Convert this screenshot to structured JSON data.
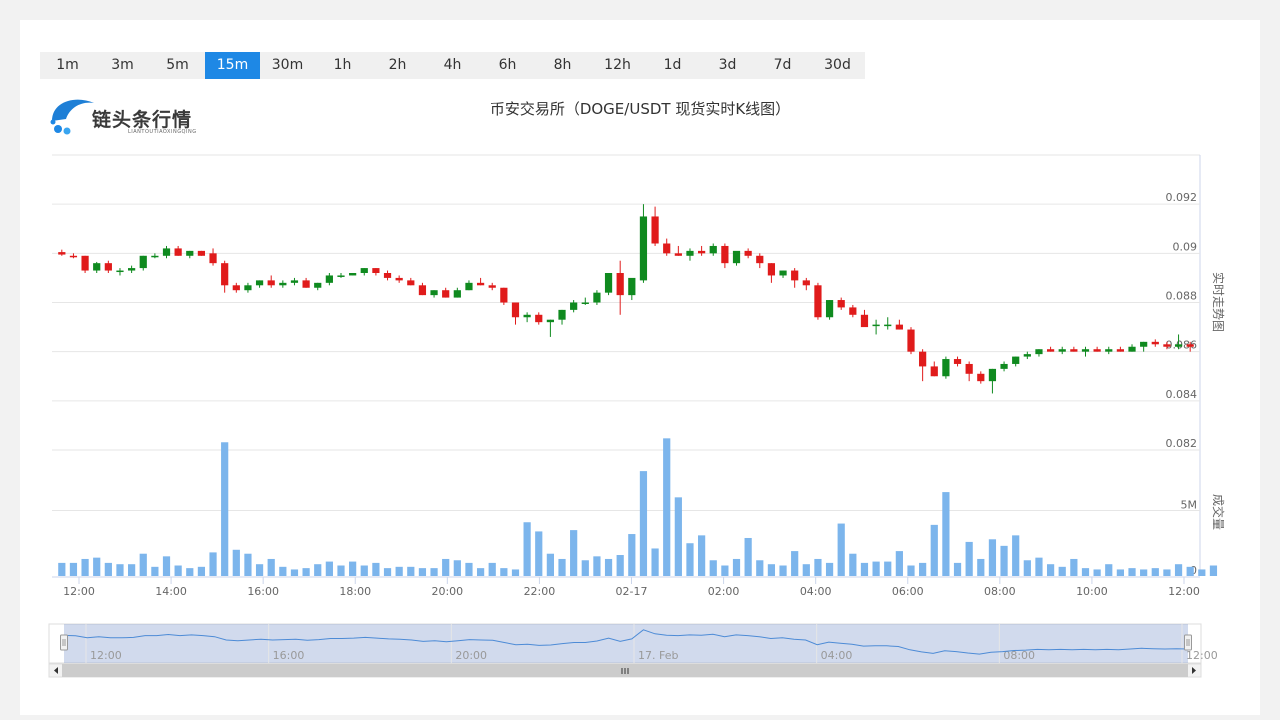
{
  "timeframes": [
    "1m",
    "3m",
    "5m",
    "15m",
    "30m",
    "1h",
    "2h",
    "4h",
    "6h",
    "8h",
    "12h",
    "1d",
    "3d",
    "7d",
    "30d"
  ],
  "active_timeframe": "15m",
  "logo": {
    "name": "链头条行情",
    "sub": "LIANTOUTIAOXINGQING"
  },
  "title": "币安交易所（DOGE/USDT 现货实时K线图）",
  "colors": {
    "up": "#0f8a1f",
    "down": "#e01b1b",
    "volume": "#7cb5ec",
    "accent": "#1e88e5"
  },
  "chart_data": {
    "type": "candlestick",
    "price_axis": {
      "label": "实时走势图",
      "ticks": [
        "0.092",
        "0.09",
        "0.088",
        "0.086",
        "0.084",
        "0.082"
      ],
      "ylim": [
        0.082,
        0.094
      ]
    },
    "volume_axis": {
      "label": "成交量",
      "ticks": [
        "5M",
        "0"
      ],
      "ylim": [
        0,
        9
      ]
    },
    "x_ticks": [
      "12:00",
      "14:00",
      "16:00",
      "18:00",
      "20:00",
      "22:00",
      "02-17",
      "02:00",
      "04:00",
      "06:00",
      "08:00",
      "10:00",
      "12:00"
    ],
    "navigator_ticks": [
      "12:00",
      "16:00",
      "20:00",
      "17. Feb",
      "04:00",
      "08:00",
      "12:00"
    ],
    "candles_ohlc": [
      [
        0.09005,
        0.09015,
        0.0899,
        0.08995
      ],
      [
        0.0899,
        0.09,
        0.0898,
        0.08985
      ],
      [
        0.0899,
        0.0899,
        0.0892,
        0.0893
      ],
      [
        0.0893,
        0.08965,
        0.0892,
        0.0896
      ],
      [
        0.0896,
        0.0897,
        0.0892,
        0.0893
      ],
      [
        0.0893,
        0.0894,
        0.0891,
        0.0893
      ],
      [
        0.0893,
        0.0895,
        0.0892,
        0.0894
      ],
      [
        0.0894,
        0.0899,
        0.0893,
        0.0899
      ],
      [
        0.0899,
        0.09,
        0.0898,
        0.0899
      ],
      [
        0.0899,
        0.0903,
        0.0898,
        0.0902
      ],
      [
        0.0902,
        0.0903,
        0.0899,
        0.0899
      ],
      [
        0.0899,
        0.0901,
        0.0898,
        0.0901
      ],
      [
        0.0901,
        0.0901,
        0.0899,
        0.0899
      ],
      [
        0.09,
        0.0902,
        0.0895,
        0.0896
      ],
      [
        0.0896,
        0.0897,
        0.0884,
        0.0887
      ],
      [
        0.0887,
        0.0888,
        0.0884,
        0.0885
      ],
      [
        0.0885,
        0.0888,
        0.0884,
        0.0887
      ],
      [
        0.0887,
        0.0889,
        0.0886,
        0.0889
      ],
      [
        0.0889,
        0.0891,
        0.0886,
        0.0887
      ],
      [
        0.0887,
        0.0889,
        0.0886,
        0.0888
      ],
      [
        0.0888,
        0.089,
        0.0887,
        0.0889
      ],
      [
        0.0889,
        0.089,
        0.0886,
        0.0886
      ],
      [
        0.0886,
        0.0888,
        0.0885,
        0.0888
      ],
      [
        0.0888,
        0.0892,
        0.0887,
        0.0891
      ],
      [
        0.0891,
        0.0892,
        0.089,
        0.0891
      ],
      [
        0.0891,
        0.0892,
        0.0891,
        0.0892
      ],
      [
        0.0892,
        0.0894,
        0.0891,
        0.0894
      ],
      [
        0.0894,
        0.0894,
        0.0891,
        0.0892
      ],
      [
        0.0892,
        0.0893,
        0.0889,
        0.089
      ],
      [
        0.089,
        0.0891,
        0.0888,
        0.0889
      ],
      [
        0.0889,
        0.089,
        0.0887,
        0.0887
      ],
      [
        0.0887,
        0.0888,
        0.0883,
        0.0883
      ],
      [
        0.0883,
        0.0885,
        0.0882,
        0.0885
      ],
      [
        0.0885,
        0.0886,
        0.0882,
        0.0882
      ],
      [
        0.0882,
        0.0886,
        0.0882,
        0.0885
      ],
      [
        0.0885,
        0.0889,
        0.0885,
        0.0888
      ],
      [
        0.0888,
        0.089,
        0.0887,
        0.0887
      ],
      [
        0.0887,
        0.0888,
        0.0885,
        0.0886
      ],
      [
        0.0886,
        0.0886,
        0.0879,
        0.088
      ],
      [
        0.088,
        0.088,
        0.0871,
        0.0874
      ],
      [
        0.0874,
        0.0876,
        0.0872,
        0.0875
      ],
      [
        0.0875,
        0.0876,
        0.0871,
        0.0872
      ],
      [
        0.0872,
        0.0873,
        0.0866,
        0.0873
      ],
      [
        0.0873,
        0.0877,
        0.0871,
        0.0877
      ],
      [
        0.0877,
        0.0881,
        0.0876,
        0.088
      ],
      [
        0.088,
        0.0882,
        0.0879,
        0.088
      ],
      [
        0.088,
        0.0885,
        0.0879,
        0.0884
      ],
      [
        0.0884,
        0.0892,
        0.0883,
        0.0892
      ],
      [
        0.0892,
        0.0897,
        0.0875,
        0.0883
      ],
      [
        0.0883,
        0.0889,
        0.0881,
        0.089
      ],
      [
        0.0889,
        0.092,
        0.0888,
        0.0915
      ],
      [
        0.0915,
        0.0919,
        0.0903,
        0.0904
      ],
      [
        0.0904,
        0.0906,
        0.0899,
        0.09
      ],
      [
        0.09,
        0.0903,
        0.0899,
        0.0899
      ],
      [
        0.0899,
        0.0902,
        0.0897,
        0.0901
      ],
      [
        0.0901,
        0.0903,
        0.0899,
        0.09
      ],
      [
        0.09,
        0.0904,
        0.0899,
        0.0903
      ],
      [
        0.0903,
        0.0904,
        0.0894,
        0.0896
      ],
      [
        0.0896,
        0.09,
        0.0895,
        0.0901
      ],
      [
        0.0901,
        0.0902,
        0.0898,
        0.0899
      ],
      [
        0.0899,
        0.09,
        0.0894,
        0.0896
      ],
      [
        0.0896,
        0.0896,
        0.0888,
        0.0891
      ],
      [
        0.0891,
        0.0893,
        0.089,
        0.0893
      ],
      [
        0.0893,
        0.0894,
        0.0886,
        0.0889
      ],
      [
        0.0889,
        0.089,
        0.0885,
        0.0887
      ],
      [
        0.0887,
        0.0888,
        0.0873,
        0.0874
      ],
      [
        0.0874,
        0.0881,
        0.0873,
        0.0881
      ],
      [
        0.0881,
        0.0882,
        0.0877,
        0.0878
      ],
      [
        0.0878,
        0.0879,
        0.0874,
        0.0875
      ],
      [
        0.0875,
        0.0877,
        0.0871,
        0.087
      ],
      [
        0.0871,
        0.0873,
        0.0867,
        0.0871
      ],
      [
        0.0871,
        0.0874,
        0.0869,
        0.0871
      ],
      [
        0.0871,
        0.0873,
        0.0869,
        0.0869
      ],
      [
        0.0869,
        0.087,
        0.0859,
        0.086
      ],
      [
        0.086,
        0.0861,
        0.0848,
        0.0854
      ],
      [
        0.0854,
        0.0856,
        0.085,
        0.085
      ],
      [
        0.085,
        0.0858,
        0.0849,
        0.0857
      ],
      [
        0.0857,
        0.0858,
        0.0854,
        0.0855
      ],
      [
        0.0855,
        0.0856,
        0.0848,
        0.0851
      ],
      [
        0.0851,
        0.0852,
        0.0847,
        0.0848
      ],
      [
        0.0848,
        0.0853,
        0.0843,
        0.0853
      ],
      [
        0.0853,
        0.0856,
        0.0852,
        0.0855
      ],
      [
        0.0855,
        0.0858,
        0.0854,
        0.0858
      ],
      [
        0.0858,
        0.086,
        0.0857,
        0.0859
      ],
      [
        0.0859,
        0.0861,
        0.0858,
        0.0861
      ],
      [
        0.0861,
        0.0862,
        0.086,
        0.086
      ],
      [
        0.086,
        0.0862,
        0.0859,
        0.0861
      ],
      [
        0.0861,
        0.0862,
        0.086,
        0.086
      ],
      [
        0.086,
        0.0862,
        0.0858,
        0.0861
      ],
      [
        0.0861,
        0.0862,
        0.086,
        0.086
      ],
      [
        0.086,
        0.0862,
        0.0859,
        0.0861
      ],
      [
        0.0861,
        0.0862,
        0.086,
        0.086
      ],
      [
        0.086,
        0.0863,
        0.086,
        0.0862
      ],
      [
        0.0862,
        0.0864,
        0.086,
        0.0864
      ],
      [
        0.0864,
        0.0865,
        0.0862,
        0.0863
      ],
      [
        0.0863,
        0.0864,
        0.0861,
        0.0862
      ],
      [
        0.0862,
        0.0867,
        0.0861,
        0.0863
      ],
      [
        0.0863,
        0.0864,
        0.086,
        0.0862
      ]
    ],
    "volumes_m": [
      1.0,
      1.0,
      1.3,
      1.4,
      1.0,
      0.9,
      0.9,
      1.7,
      0.7,
      1.5,
      0.8,
      0.6,
      0.7,
      1.8,
      10.2,
      2.0,
      1.7,
      0.9,
      1.3,
      0.7,
      0.5,
      0.6,
      0.9,
      1.1,
      0.8,
      1.1,
      0.8,
      1.0,
      0.6,
      0.7,
      0.7,
      0.6,
      0.6,
      1.3,
      1.2,
      1.0,
      0.6,
      1.0,
      0.6,
      0.5,
      4.1,
      3.4,
      1.7,
      1.3,
      3.5,
      1.2,
      1.5,
      1.3,
      1.6,
      3.2,
      8.0,
      2.1,
      10.5,
      6.0,
      2.5,
      3.1,
      1.2,
      0.8,
      1.3,
      2.9,
      1.2,
      0.9,
      0.8,
      1.9,
      0.9,
      1.3,
      1.0,
      4.0,
      1.7,
      1.0,
      1.1,
      1.1,
      1.9,
      0.8,
      1.0,
      3.9,
      6.4,
      1.0,
      2.6,
      1.3,
      2.8,
      2.3,
      3.1,
      1.2,
      1.4,
      0.9,
      0.7,
      1.3,
      0.6,
      0.5,
      0.9,
      0.5,
      0.6,
      0.5,
      0.6,
      0.5,
      0.9,
      0.7,
      0.5,
      0.8
    ]
  }
}
